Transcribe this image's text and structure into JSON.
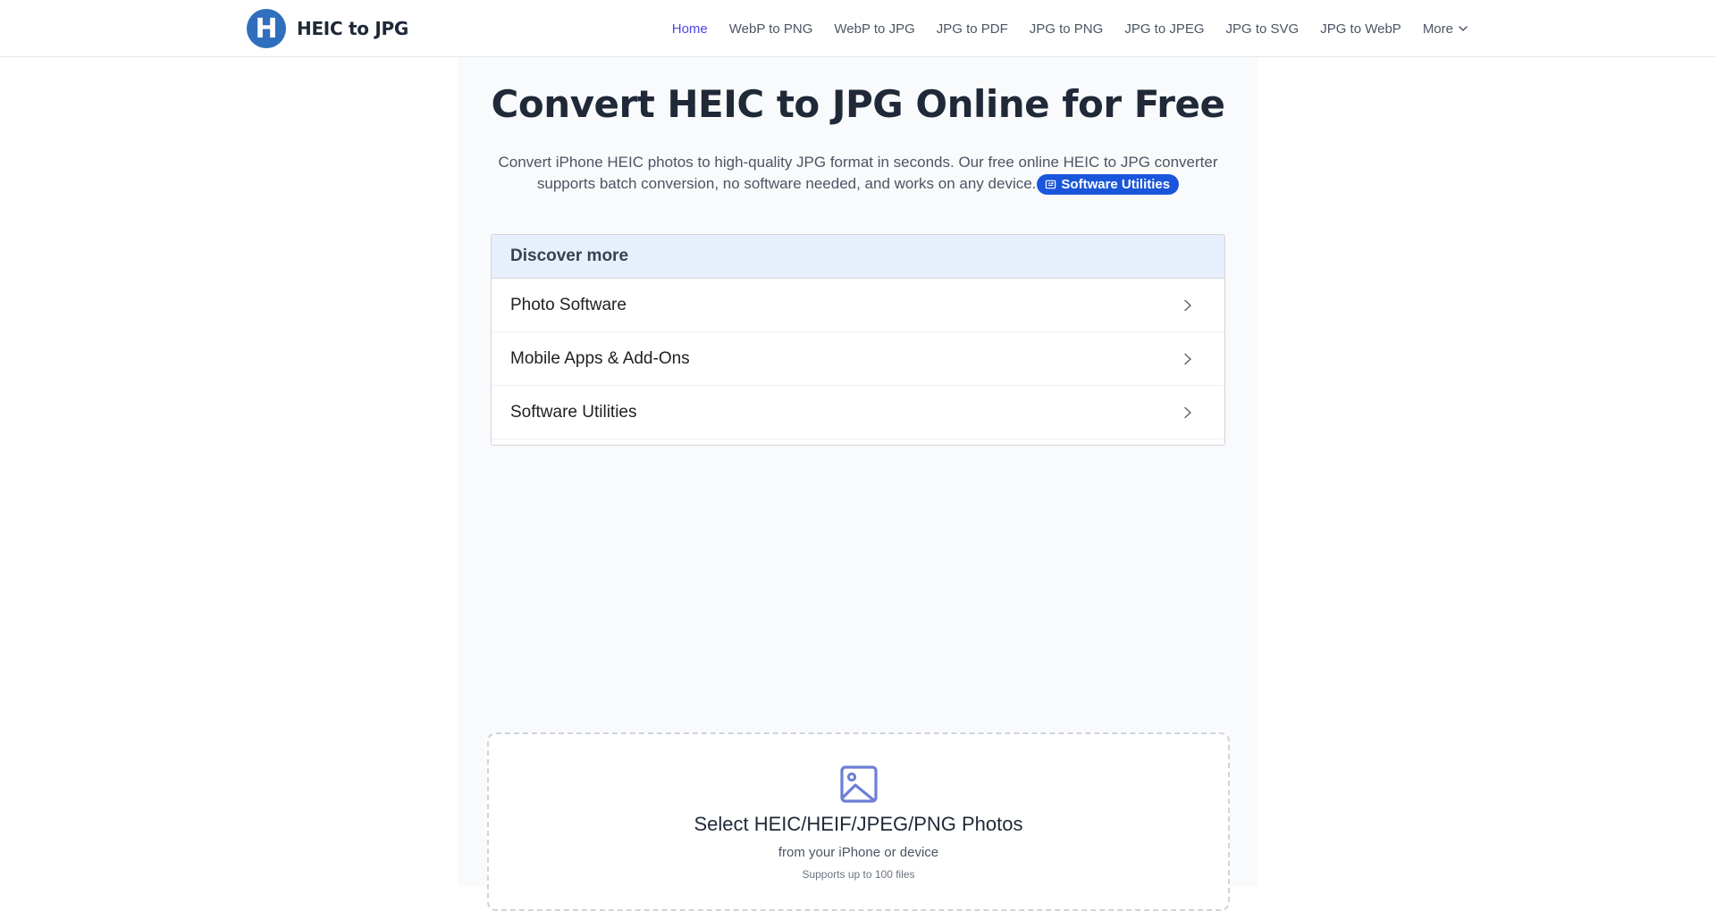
{
  "header": {
    "logo_letter": "H",
    "logo_text": "HEIC to JPG",
    "nav": [
      {
        "label": "Home",
        "active": true
      },
      {
        "label": "WebP to PNG"
      },
      {
        "label": "WebP to JPG"
      },
      {
        "label": "JPG to PDF"
      },
      {
        "label": "JPG to PNG"
      },
      {
        "label": "JPG to JPEG"
      },
      {
        "label": "JPG to SVG"
      },
      {
        "label": "JPG to WebP"
      },
      {
        "label": "More",
        "icon": "chevron-down-icon"
      }
    ]
  },
  "hero": {
    "title": "Convert HEIC to JPG Online for Free",
    "subtitle": "Convert iPhone HEIC photos to high-quality JPG format in seconds. Our free online HEIC to JPG converter supports batch conversion, no software needed, and works on any device.",
    "pill_label": "Software Utilities",
    "pill_icon": "newspaper-icon"
  },
  "discover": {
    "heading": "Discover more",
    "items": [
      {
        "label": "Photo Software"
      },
      {
        "label": "Mobile Apps & Add-Ons"
      },
      {
        "label": "Software Utilities"
      }
    ]
  },
  "upload": {
    "icon": "image-icon",
    "title": "Select HEIC/HEIF/JPEG/PNG Photos",
    "subtitle": "from your iPhone or device",
    "note": "Supports up to 100 files"
  },
  "colors": {
    "accent": "#4f46e5",
    "logo": "#2f6fbd",
    "pill": "#1a56db",
    "discover_head": "#e8effc",
    "upload_icon": "#6b7fd7"
  }
}
